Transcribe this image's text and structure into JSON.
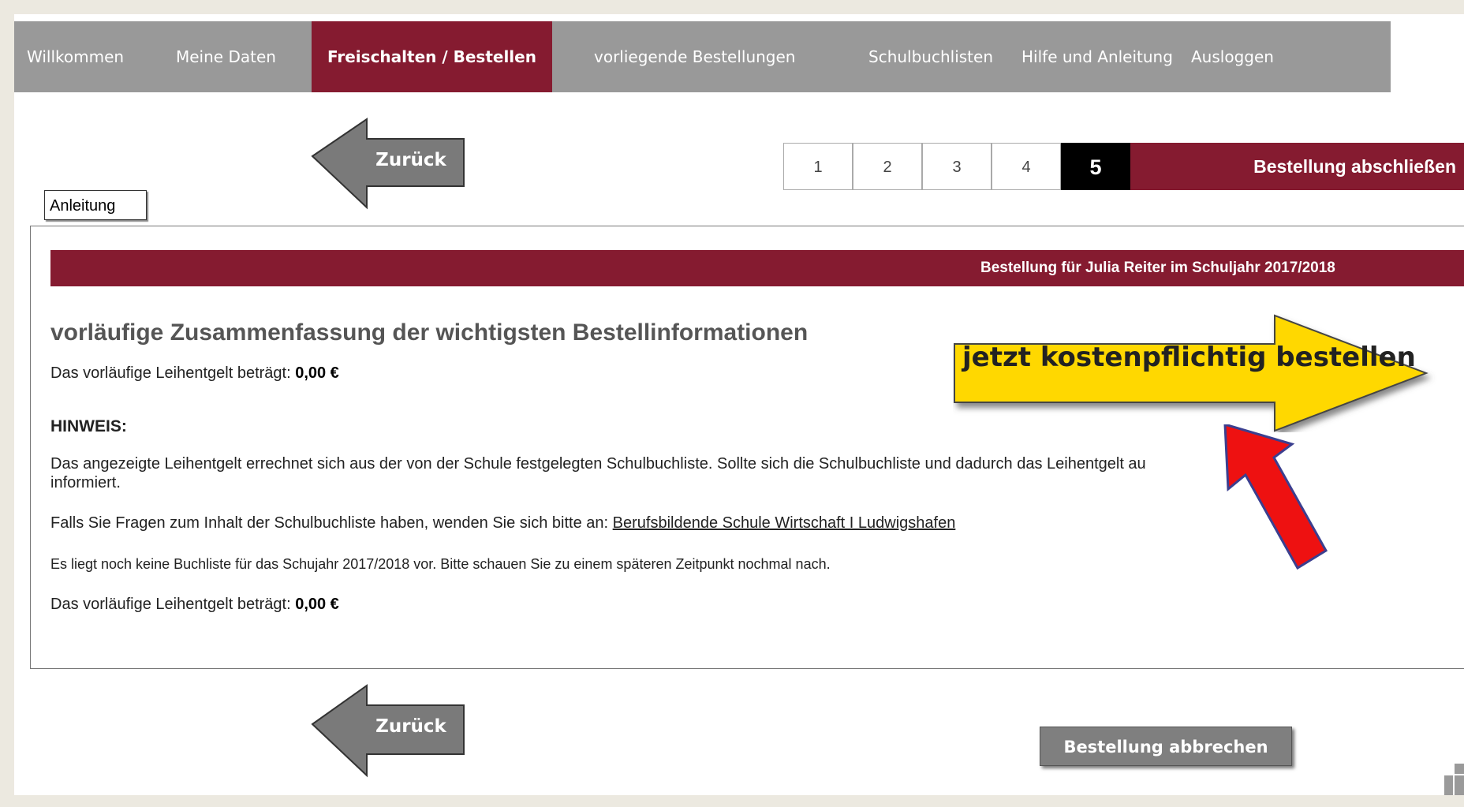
{
  "nav": {
    "items": [
      {
        "label": "Willkommen",
        "active": false
      },
      {
        "label": "Meine Daten",
        "active": false
      },
      {
        "label": "Freischalten / Bestellen",
        "active": true
      },
      {
        "label": "vorliegende Bestellungen",
        "active": false
      },
      {
        "label": "Schulbuchlisten",
        "active": false
      },
      {
        "label": "Hilfe und Anleitung",
        "active": false
      },
      {
        "label": "Ausloggen",
        "active": false
      }
    ]
  },
  "toolbar": {
    "back_label": "Zurück",
    "anleitung_label": "Anleitung"
  },
  "steps": {
    "items": [
      "1",
      "2",
      "3",
      "4",
      "5"
    ],
    "current": "5",
    "title": "Bestellung abschließen"
  },
  "order": {
    "bar_text": "Bestellung für Julia Reiter im Schuljahr 2017/2018",
    "summary_title": "vorläufige Zusammenfassung der wichtigsten Bestellinformationen",
    "fee_prefix": "Das vorläufige Leihentgelt beträgt: ",
    "fee_value": "0,00 €",
    "hinweis_label": "HINWEIS:",
    "hinweis_line1": "Das angezeigte Leihentgelt errechnet sich aus der von der Schule festgelegten Schulbuchliste. Sollte sich die Schulbuchliste und dadurch das Leihentgelt au",
    "hinweis_line2": "informiert.",
    "questions_prefix": "Falls Sie Fragen zum Inhalt der Schulbuchliste haben, wenden Sie sich bitte an: ",
    "school_link": "Berufsbildende Schule Wirtschaft I Ludwigshafen",
    "no_list_text": "Es liegt noch keine Buchliste für das Schujahr 2017/2018 vor. Bitte schauen Sie zu einem späteren Zeitpunkt nochmal nach.",
    "fee_prefix_2": "Das vorläufige Leihentgelt beträgt: ",
    "fee_value_2": "0,00 €"
  },
  "cta": {
    "label": "jetzt kostenpflichtig bestellen",
    "fill_color": "#ffd800",
    "pointer_color": "#ee1111"
  },
  "footer": {
    "back_label": "Zurück",
    "cancel_label": "Bestellung abbrechen"
  },
  "colors": {
    "brand": "#851b30",
    "nav_bg": "#999999",
    "button_gray": "#7f7f7f"
  }
}
